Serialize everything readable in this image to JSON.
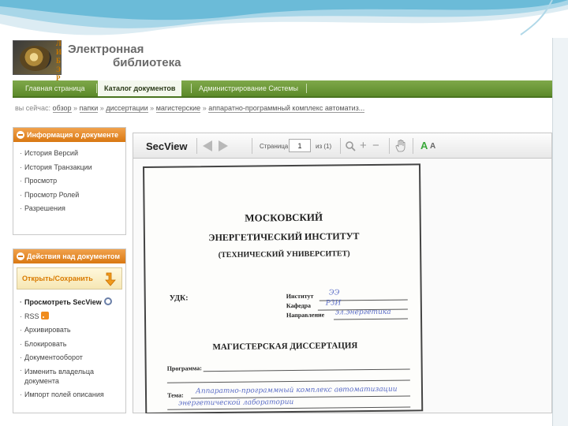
{
  "header": {
    "logo_letters": [
      "Л",
      "И",
      "Б",
      "Э",
      "Р"
    ],
    "title_line1": "Электронная",
    "title_line2": "библиотека"
  },
  "nav": {
    "items": [
      {
        "label": "Главная страница"
      },
      {
        "label": "Каталог документов",
        "active": true
      },
      {
        "label": "Администрирование Системы"
      }
    ]
  },
  "breadcrumbs": {
    "prefix": "вы сейчас:",
    "items": [
      "обзор",
      "папки",
      "диссертации",
      "магистерские",
      "аппаратно-программный комплекс автоматиз..."
    ],
    "separator": "»"
  },
  "info_panel": {
    "title": "Информация о документе",
    "items": [
      "История Версий",
      "История Транзакции",
      "Просмотр",
      "Просмотр Ролей",
      "Разрешения"
    ]
  },
  "actions_panel": {
    "title": "Действия над документом",
    "open_save": "Открыть/Сохранить",
    "items": [
      "Просмотреть SecView",
      "RSS",
      "Архивировать",
      "Блокировать",
      "Документооборот",
      "Изменить владельца документа",
      "Импорт полей описания"
    ]
  },
  "viewer": {
    "brand": "SecView",
    "page_label": "Страница",
    "page_value": "1",
    "page_of": "из (1)",
    "font_large": "A",
    "font_small": "A",
    "icons": [
      "prev-page-icon",
      "next-page-icon",
      "zoom-icon",
      "zoom-in-icon",
      "zoom-out-icon",
      "hand-tool-icon"
    ]
  },
  "document": {
    "line1": "МОСКОВСКИЙ",
    "line2": "ЭНЕРГЕТИЧЕСКИЙ ИНСТИТУТ",
    "line3": "(ТЕХНИЧЕСКИЙ УНИВЕРСИТЕТ)",
    "udk": "УДК:",
    "institute_label": "Институт",
    "institute_value": "ЭЭ",
    "chair_label": "Кафедра",
    "chair_value": "РЗИ",
    "direction_label": "Направление",
    "direction_value": "эл.энергетика",
    "dissertation": "МАГИСТЕРСКАЯ ДИССЕРТАЦИЯ",
    "program_label": "Программа:",
    "theme_label": "Тема:",
    "theme_value": "Аппаратно-программный комплекс автоматизации",
    "theme_value2": "энергетической лаборатории"
  },
  "colors": {
    "nav_green": "#6a9a36",
    "panel_orange": "#e08a2a",
    "accent_green": "#3aa83a"
  }
}
